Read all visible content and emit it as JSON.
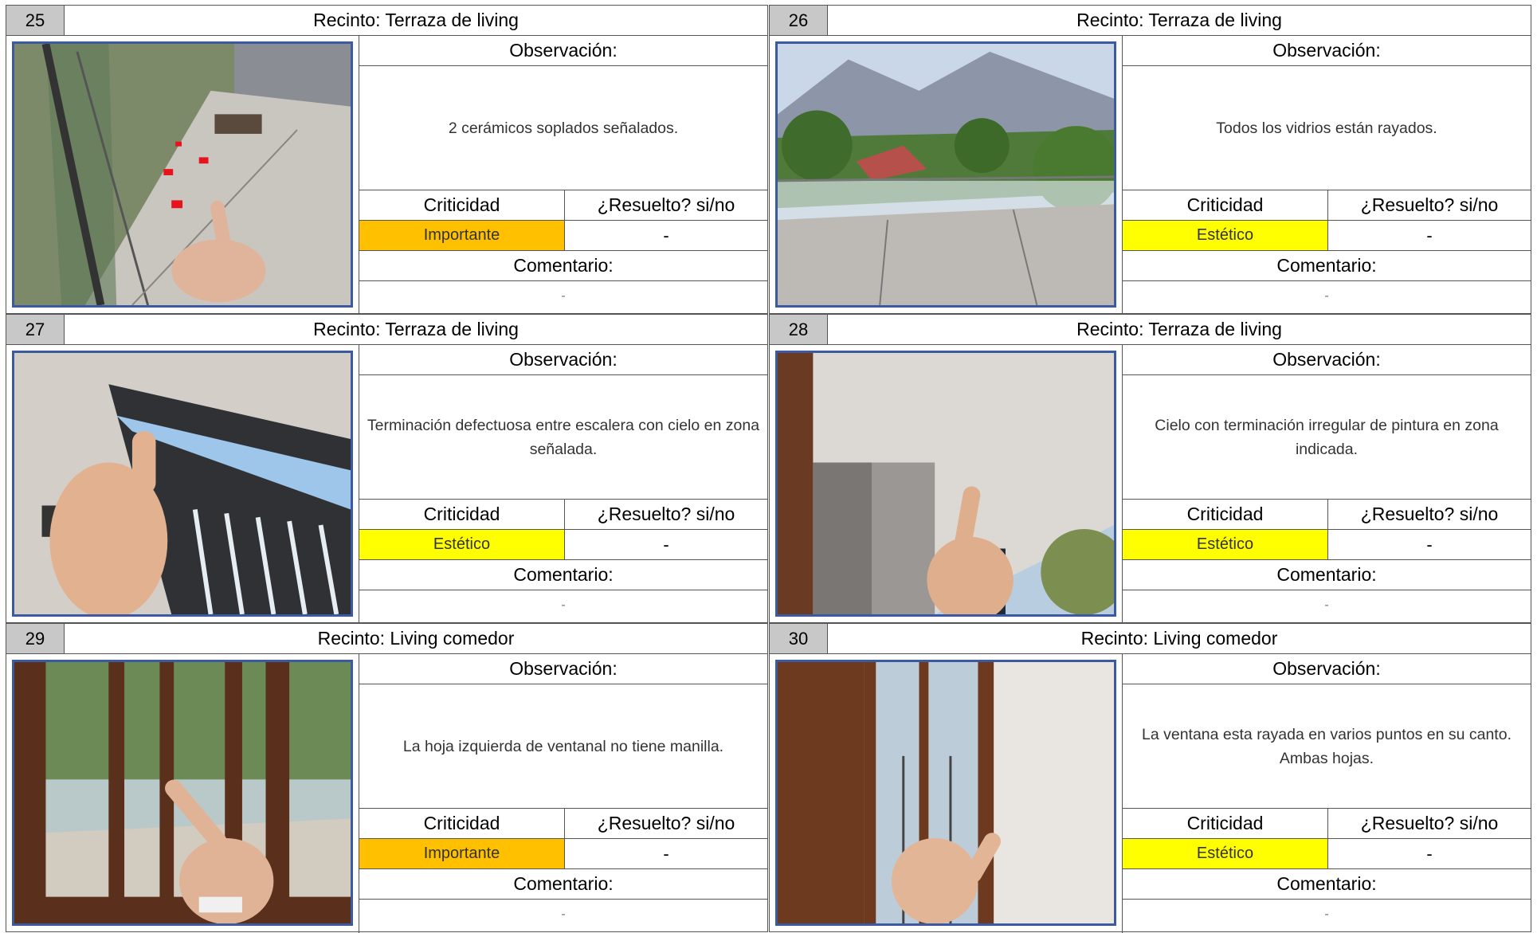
{
  "labels": {
    "observacion": "Observación:",
    "criticidad": "Criticidad",
    "resuelto": "¿Resuelto? si/no",
    "comentario": "Comentario:"
  },
  "colors": {
    "importante": "#FFC000",
    "estetico": "#FFFF00",
    "photo_border": "#3C5AA0",
    "number_cell": "#C8C8C8"
  },
  "cards": [
    {
      "number": "25",
      "recinto": "Recinto: Terraza de living",
      "observacion": "2 cerámicos soplados señalados.",
      "criticidad": "Importante",
      "criticidad_level": "importante",
      "resuelto": "-",
      "comentario": "-",
      "photo": "terrace-floor-tiles"
    },
    {
      "number": "26",
      "recinto": "Recinto: Terraza de living",
      "observacion": "Todos los vidrios están rayados.",
      "criticidad": "Estético",
      "criticidad_level": "estetico",
      "resuelto": "-",
      "comentario": "-",
      "photo": "terrace-glass-railing"
    },
    {
      "number": "27",
      "recinto": "Recinto: Terraza de living",
      "observacion": "Terminación defectuosa entre escalera con cielo en zona señalada.",
      "criticidad": "Estético",
      "criticidad_level": "estetico",
      "resuelto": "-",
      "comentario": "-",
      "photo": "stair-ceiling-junction"
    },
    {
      "number": "28",
      "recinto": "Recinto: Terraza de living",
      "observacion": "Cielo con terminación irregular de pintura en zona indicada.",
      "criticidad": "Estético",
      "criticidad_level": "estetico",
      "resuelto": "-",
      "comentario": "-",
      "photo": "ceiling-paint"
    },
    {
      "number": "29",
      "recinto": "Recinto: Living comedor",
      "observacion": "La hoja izquierda de ventanal no tiene manilla.",
      "criticidad": "Importante",
      "criticidad_level": "importante",
      "resuelto": "-",
      "comentario": "-",
      "photo": "sliding-window"
    },
    {
      "number": "30",
      "recinto": "Recinto: Living comedor",
      "observacion": "La ventana esta rayada en varios puntos en su canto. Ambas hojas.",
      "criticidad": "Estético",
      "criticidad_level": "estetico",
      "resuelto": "-",
      "comentario": "-",
      "photo": "window-frame"
    }
  ]
}
